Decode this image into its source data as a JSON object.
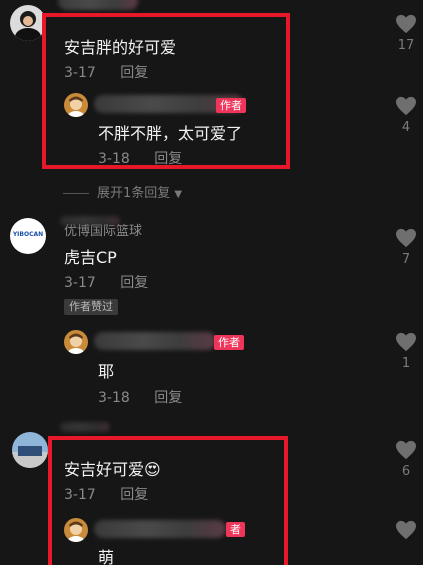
{
  "comments": [
    {
      "text": "安吉胖的好可爱",
      "date": "3-17",
      "reply_label": "回复",
      "likes": "17",
      "reply": {
        "author_badge": "作者",
        "text": "不胖不胖，太可爱了",
        "date": "3-18",
        "reply_label": "回复",
        "likes": "4"
      },
      "expand_label": "展开1条回复"
    },
    {
      "user": "优博国际篮球",
      "avatar_text": "YIBOCAN",
      "text": "虎吉CP",
      "date": "3-17",
      "reply_label": "回复",
      "likes": "7",
      "liked_badge": "作者赞过",
      "reply": {
        "author_badge": "作者",
        "text": "耶",
        "date": "3-18",
        "reply_label": "回复",
        "likes": "1"
      }
    },
    {
      "text": "安吉好可爱😍",
      "date": "3-17",
      "reply_label": "回复",
      "likes": "6",
      "reply": {
        "author_badge": "者",
        "text": "萌",
        "likes": ""
      }
    }
  ],
  "colors": {
    "background": "#161616",
    "author_badge": "#f0355a",
    "highlight": "#e8182a"
  }
}
